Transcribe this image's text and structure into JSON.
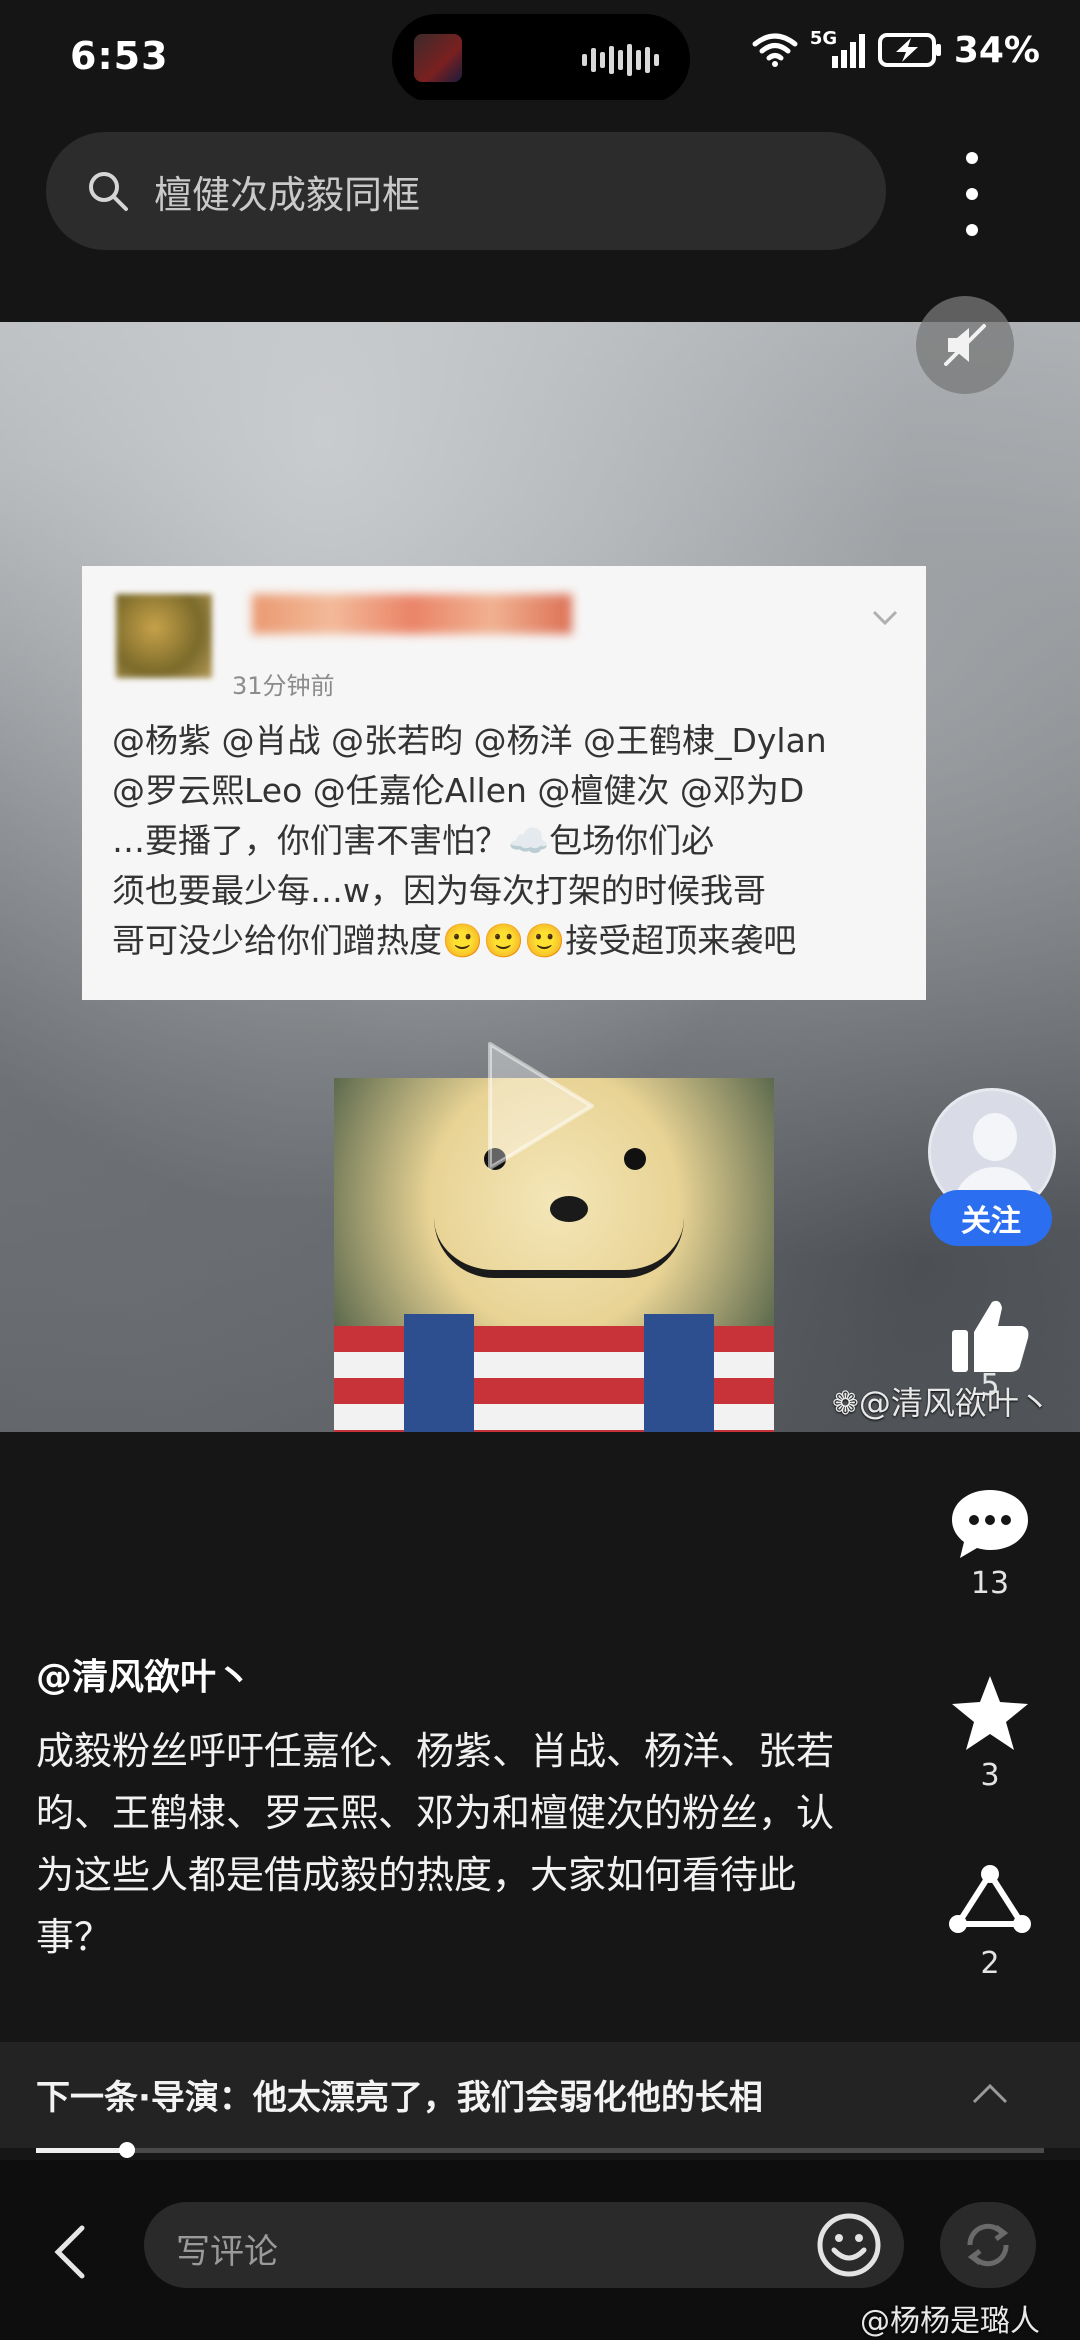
{
  "status_bar": {
    "time": "6:53",
    "network": "5G",
    "battery": "34%"
  },
  "search": {
    "query": "檀健次成毅同框"
  },
  "video": {
    "card": {
      "time": "31分钟前",
      "lines": [
        "@杨紫 @肖战 @张若昀 @杨洋 @王鹤棣_Dylan",
        "@罗云熙Leo @任嘉伦Allen @檀健次 @邓为D",
        "…要播了，你们害不害怕？☁️包场你们必",
        "须也要最少每…w，因为每次打架的时候我哥",
        "哥可没少给你们蹭热度🙂🙂🙂接受超顶来袭吧"
      ]
    },
    "watermark": "@清风欲叶丶"
  },
  "actions": {
    "follow_label": "关注",
    "like_count": "5",
    "comment_count": "13",
    "favorite_count": "3",
    "share_count": "2"
  },
  "post": {
    "author": "@清风欲叶丶",
    "caption": "成毅粉丝呼吁任嘉伦、杨紫、肖战、杨洋、张若昀、王鹤棣、罗云熙、邓为和檀健次的粉丝，认为这些人都是借成毅的热度，大家如何看待此事？"
  },
  "next": {
    "text": "下一条·导演：他太漂亮了，我们会弱化他的长相"
  },
  "progress": {
    "fraction": 0.09
  },
  "bottom": {
    "comment_placeholder": "写评论"
  },
  "page_watermark": "@杨杨是璐人",
  "colors": {
    "accent": "#2b6ff0",
    "background": "#161616"
  }
}
